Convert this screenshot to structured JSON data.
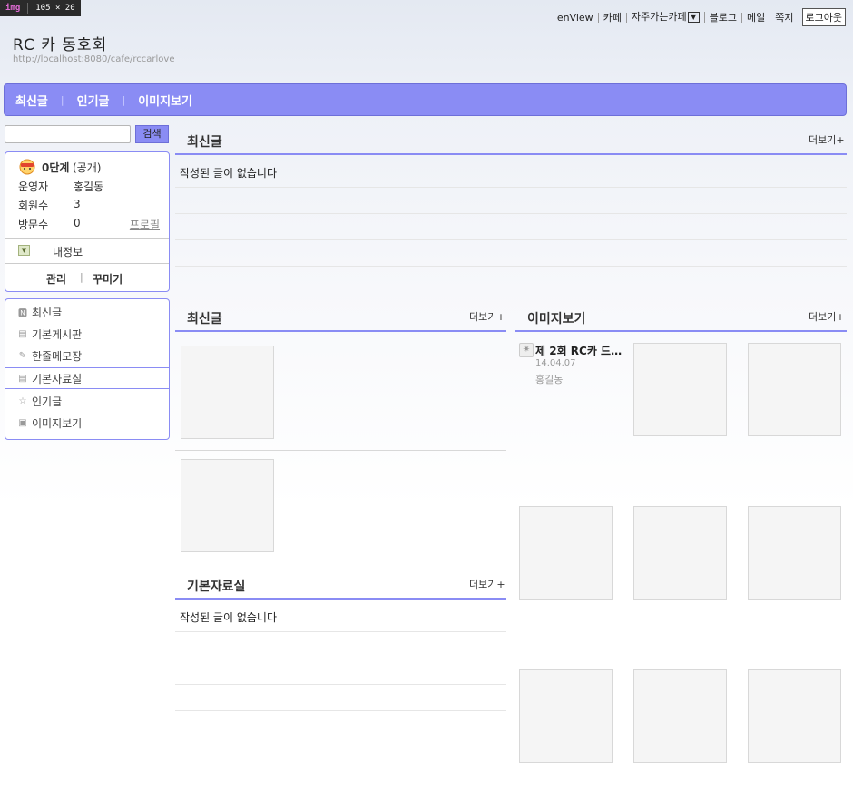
{
  "devtool": {
    "tag": "img",
    "size": "105 × 20"
  },
  "top_links": {
    "enview": "enView",
    "cafe": "카페",
    "favorite_cafe": "자주가는카페",
    "blog": "블로그",
    "mail": "메일",
    "note": "쪽지",
    "logout": "로그아웃"
  },
  "cafe": {
    "title": "RC 카 동호회",
    "url": "http://localhost:8080/cafe/rccarlove"
  },
  "nav": [
    "최신글",
    "인기글",
    "이미지보기"
  ],
  "search": {
    "placeholder": "",
    "button": "검색"
  },
  "profile": {
    "level": "0단계",
    "visibility": "(공개)",
    "manager_label": "운영자",
    "manager_value": "홍길동",
    "members_label": "회원수",
    "members_value": "3",
    "visits_label": "방문수",
    "visits_value": "0",
    "profile_link": "프로필",
    "myinfo": "내정보",
    "manage": "관리",
    "decorate": "꾸미기"
  },
  "menu": [
    {
      "label": "최신글",
      "icon": "new-icon"
    },
    {
      "label": "기본게시판",
      "icon": "board-icon"
    },
    {
      "label": "한줄메모장",
      "icon": "pencil-icon"
    },
    {
      "label": "기본자료실",
      "icon": "board-icon"
    },
    {
      "label": "인기글",
      "icon": "star-icon"
    },
    {
      "label": "이미지보기",
      "icon": "image-icon"
    }
  ],
  "sections": {
    "latest_top": {
      "title": "최신글",
      "more": "더보기+",
      "empty": "작성된 글이 없습니다"
    },
    "latest_bottom": {
      "title": "최신글",
      "more": "더보기+"
    },
    "images": {
      "title": "이미지보기",
      "more": "더보기+"
    },
    "archive": {
      "title": "기본자료실",
      "more": "더보기+",
      "empty": "작성된 글이 없습니다"
    }
  },
  "image_post": {
    "title": "제 2회 RC카 드…",
    "date": "14.04.07",
    "author": "홍길동"
  },
  "colors": {
    "accent": "#8a8cf4",
    "accent_border": "#6d6fd8"
  }
}
